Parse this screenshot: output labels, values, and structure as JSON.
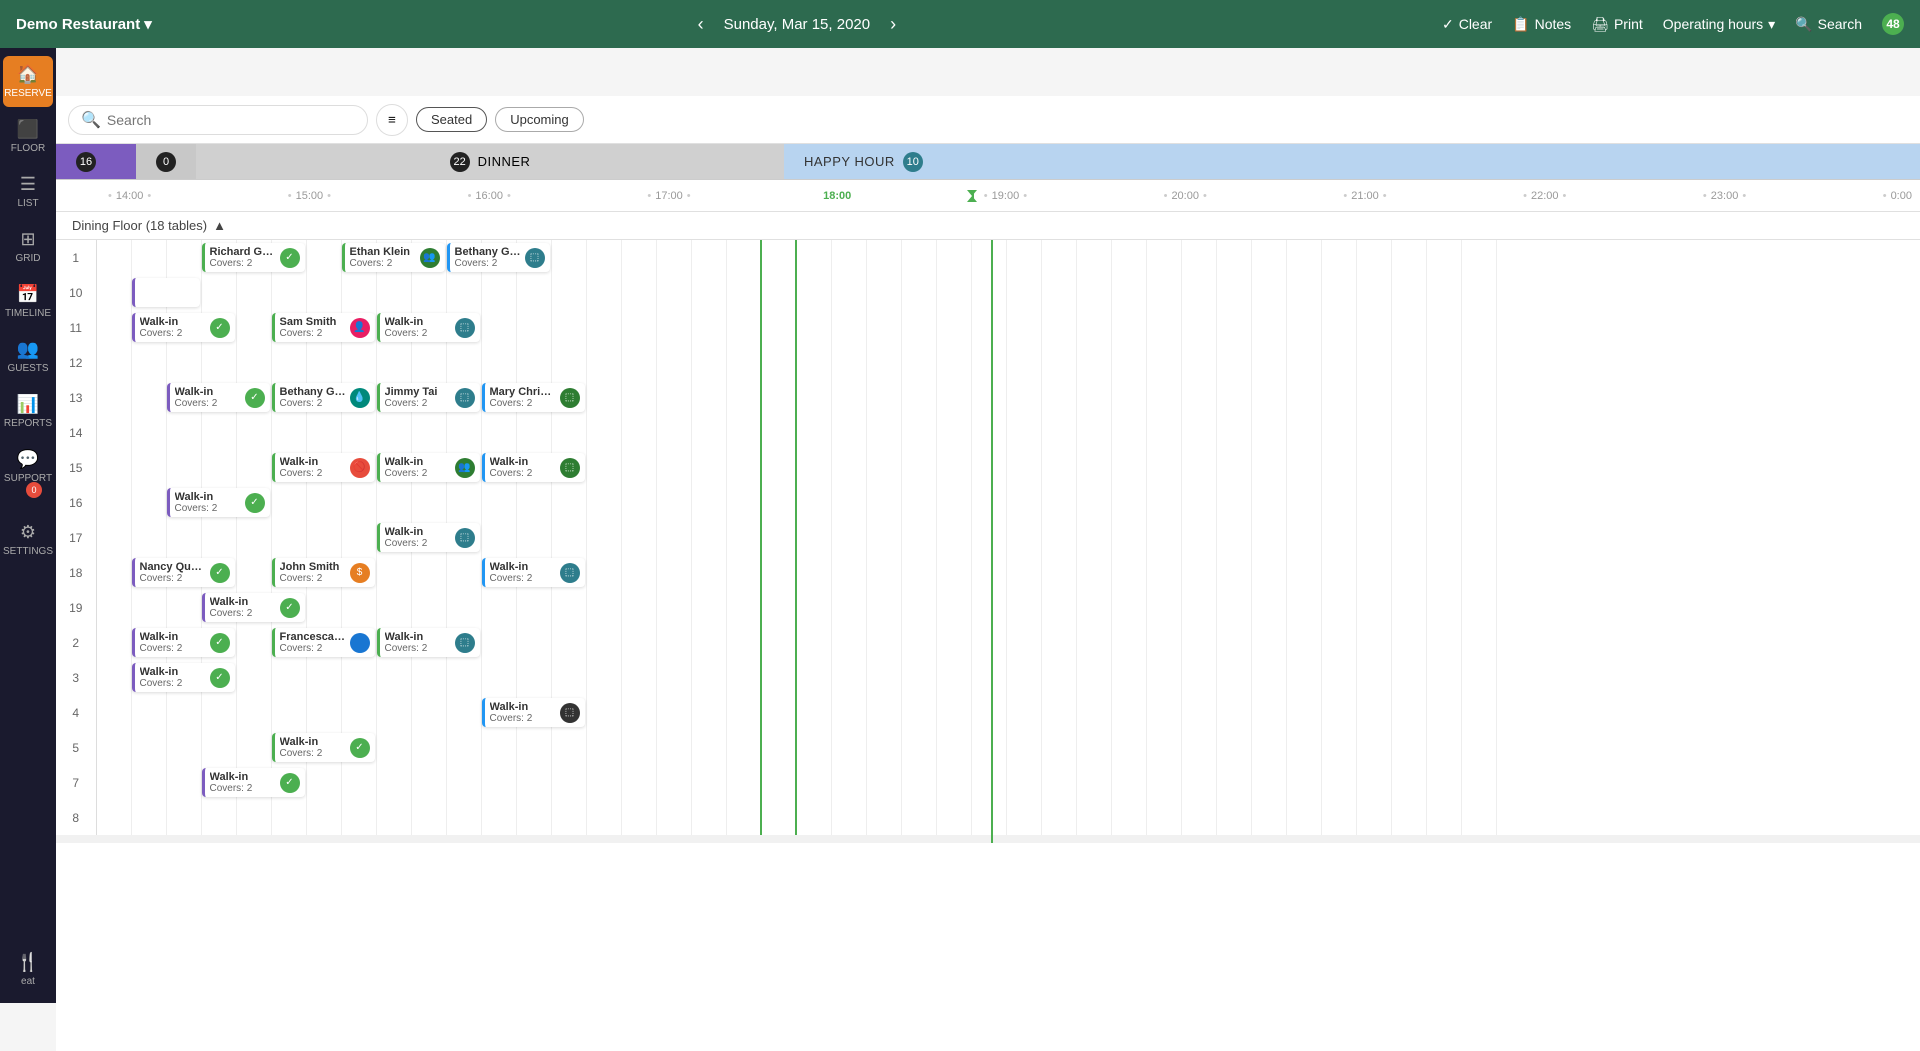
{
  "app": {
    "restaurant_name": "Demo Restaurant",
    "date": "Sunday, Mar 15, 2020",
    "nav_badge": "48"
  },
  "nav": {
    "clear_label": "Clear",
    "notes_label": "Notes",
    "print_label": "Print",
    "operating_hours_label": "Operating hours",
    "search_label": "Search"
  },
  "sidebar": {
    "items": [
      {
        "id": "reserve",
        "label": "RESERVE",
        "icon": "🏠",
        "active": true
      },
      {
        "id": "floor",
        "label": "FLOOR",
        "icon": "⬛"
      },
      {
        "id": "list",
        "label": "LIST",
        "icon": "☰"
      },
      {
        "id": "grid",
        "label": "GRID",
        "icon": "⊞"
      },
      {
        "id": "timeline",
        "label": "TIMELINE",
        "icon": "📅"
      },
      {
        "id": "guests",
        "label": "GUESTS",
        "icon": "👥"
      },
      {
        "id": "reports",
        "label": "REPORTS",
        "icon": "📊"
      },
      {
        "id": "support",
        "label": "SUPPORT",
        "icon": "💬",
        "badge": "0"
      },
      {
        "id": "settings",
        "label": "SETTINGS",
        "icon": "⚙"
      },
      {
        "id": "eat",
        "label": "eat",
        "icon": "🍽"
      }
    ]
  },
  "toolbar": {
    "search_placeholder": "Search",
    "seated_label": "Seated",
    "upcoming_label": "Upcoming"
  },
  "sections": [
    {
      "id": "section1",
      "badge": "16",
      "badge_style": "dark",
      "bg": "purple"
    },
    {
      "id": "section2",
      "badge": "0",
      "badge_style": "dark",
      "bg": "gray"
    },
    {
      "id": "dinner",
      "label": "DINNER",
      "badge": "22",
      "badge_style": "dark",
      "bg": "light-gray"
    },
    {
      "id": "happy_hour",
      "label": "HAPPY HOUR",
      "badge": "10",
      "badge_style": "teal",
      "bg": "light-blue"
    }
  ],
  "floor_label": "Dining Floor (18 tables)",
  "times": [
    "14:00",
    "15:00",
    "16:00",
    "17:00",
    "18:00",
    "19:00",
    "20:00",
    "21:00",
    "22:00",
    "23:00",
    "0:00"
  ],
  "tables": [
    {
      "id": "1"
    },
    {
      "id": "10"
    },
    {
      "id": "11"
    },
    {
      "id": "12"
    },
    {
      "id": "13"
    },
    {
      "id": "14"
    },
    {
      "id": "15"
    },
    {
      "id": "16"
    },
    {
      "id": "17"
    },
    {
      "id": "18"
    },
    {
      "id": "19"
    },
    {
      "id": "2"
    },
    {
      "id": "3"
    },
    {
      "id": "4"
    },
    {
      "id": "5"
    },
    {
      "id": "7"
    },
    {
      "id": "8"
    }
  ],
  "reservations": [
    {
      "id": "r1",
      "table": "1",
      "name": "Richard Gato",
      "covers": "Covers: 2",
      "icon": "✓",
      "icon_style": "icon-green",
      "col_start": 4,
      "col_span": 3,
      "border": "green-border"
    },
    {
      "id": "r2",
      "table": "1",
      "name": "Ethan Klein",
      "covers": "Covers: 2",
      "icon": "👥",
      "icon_style": "icon-dark-green",
      "col_start": 8,
      "col_span": 3,
      "border": "green-border"
    },
    {
      "id": "r3",
      "table": "1",
      "name": "Bethany Green",
      "covers": "Covers: 2",
      "icon": "⬚",
      "icon_style": "icon-teal",
      "col_start": 11,
      "col_span": 3,
      "border": "blue-border"
    },
    {
      "id": "r4",
      "table": "10",
      "name": "",
      "covers": "",
      "icon": "",
      "icon_style": "",
      "col_start": 2,
      "col_span": 2,
      "border": "purple-border"
    },
    {
      "id": "r5",
      "table": "11",
      "name": "Walk-in",
      "covers": "Covers: 2",
      "icon": "✓",
      "icon_style": "icon-green",
      "col_start": 2,
      "col_span": 3,
      "border": "purple-border"
    },
    {
      "id": "r6",
      "table": "11",
      "name": "Sam Smith",
      "covers": "Covers: 2",
      "icon": "👤",
      "icon_style": "icon-pink",
      "col_start": 6,
      "col_span": 3,
      "border": "green-border"
    },
    {
      "id": "r7",
      "table": "11",
      "name": "Walk-in",
      "covers": "Covers: 2",
      "icon": "⬚",
      "icon_style": "icon-teal",
      "col_start": 9,
      "col_span": 3,
      "border": "green-border"
    },
    {
      "id": "r8",
      "table": "13",
      "name": "Walk-in",
      "covers": "Covers: 2",
      "icon": "✓",
      "icon_style": "icon-green",
      "col_start": 3,
      "col_span": 3,
      "border": "purple-border"
    },
    {
      "id": "r9",
      "table": "13",
      "name": "Bethany Green",
      "covers": "Covers: 2",
      "icon": "💧",
      "icon_style": "icon-teal2",
      "col_start": 6,
      "col_span": 3,
      "border": "green-border"
    },
    {
      "id": "r10",
      "table": "13",
      "name": "Jimmy Tai",
      "covers": "Covers: 2",
      "icon": "⬚",
      "icon_style": "icon-teal",
      "col_start": 9,
      "col_span": 3,
      "border": "green-border"
    },
    {
      "id": "r11",
      "table": "13",
      "name": "Mary Christianson",
      "covers": "Covers: 2",
      "icon": "⬚",
      "icon_style": "icon-dark-green",
      "col_start": 12,
      "col_span": 3,
      "border": "blue-border"
    },
    {
      "id": "r12",
      "table": "15",
      "name": "Walk-in",
      "covers": "Covers: 2",
      "icon": "🚫",
      "icon_style": "icon-red",
      "col_start": 6,
      "col_span": 3,
      "border": "green-border"
    },
    {
      "id": "r13",
      "table": "15",
      "name": "Walk-in",
      "covers": "Covers: 2",
      "icon": "👥",
      "icon_style": "icon-dark-green",
      "col_start": 9,
      "col_span": 3,
      "border": "green-border"
    },
    {
      "id": "r14",
      "table": "15",
      "name": "Walk-in",
      "covers": "Covers: 2",
      "icon": "⬚",
      "icon_style": "icon-dark-green",
      "col_start": 12,
      "col_span": 3,
      "border": "blue-border"
    },
    {
      "id": "r15",
      "table": "16",
      "name": "Walk-in",
      "covers": "Covers: 2",
      "icon": "✓",
      "icon_style": "icon-green",
      "col_start": 3,
      "col_span": 3,
      "border": "purple-border"
    },
    {
      "id": "r16",
      "table": "17",
      "name": "Walk-in",
      "covers": "Covers: 2",
      "icon": "⬚",
      "icon_style": "icon-teal",
      "col_start": 9,
      "col_span": 3,
      "border": "green-border"
    },
    {
      "id": "r17",
      "table": "18",
      "name": "Nancy Quentin",
      "covers": "Covers: 2",
      "icon": "✓",
      "icon_style": "icon-green",
      "col_start": 2,
      "col_span": 3,
      "border": "purple-border"
    },
    {
      "id": "r18",
      "table": "18",
      "name": "John Smith",
      "covers": "Covers: 2",
      "icon": "$",
      "icon_style": "icon-orange",
      "col_start": 6,
      "col_span": 3,
      "border": "green-border"
    },
    {
      "id": "r19",
      "table": "18",
      "name": "Walk-in",
      "covers": "Covers: 2",
      "icon": "⬚",
      "icon_style": "icon-teal",
      "col_start": 12,
      "col_span": 3,
      "border": "blue-border"
    },
    {
      "id": "r20",
      "table": "19",
      "name": "Walk-in",
      "covers": "Covers: 2",
      "icon": "✓",
      "icon_style": "icon-green",
      "col_start": 4,
      "col_span": 3,
      "border": "purple-border"
    },
    {
      "id": "r21",
      "table": "2",
      "name": "Walk-in",
      "covers": "Covers: 2",
      "icon": "✓",
      "icon_style": "icon-green",
      "col_start": 2,
      "col_span": 3,
      "border": "purple-border"
    },
    {
      "id": "r22",
      "table": "2",
      "name": "Francesca Webheinser",
      "covers": "Covers: 2",
      "icon": "👤",
      "icon_style": "icon-blue",
      "col_start": 6,
      "col_span": 3,
      "border": "green-border"
    },
    {
      "id": "r23",
      "table": "2",
      "name": "Walk-in",
      "covers": "Covers: 2",
      "icon": "⬚",
      "icon_style": "icon-teal",
      "col_start": 9,
      "col_span": 3,
      "border": "green-border"
    },
    {
      "id": "r24",
      "table": "3",
      "name": "Walk-in",
      "covers": "Covers: 2",
      "icon": "✓",
      "icon_style": "icon-green",
      "col_start": 2,
      "col_span": 3,
      "border": "purple-border"
    },
    {
      "id": "r25",
      "table": "4",
      "name": "Walk-in",
      "covers": "Covers: 2",
      "icon": "⬚",
      "icon_style": "icon-dark",
      "col_start": 12,
      "col_span": 3,
      "border": "blue-border"
    },
    {
      "id": "r26",
      "table": "5",
      "name": "Walk-in",
      "covers": "Covers: 2",
      "icon": "✓",
      "icon_style": "icon-green",
      "col_start": 6,
      "col_span": 3,
      "border": "green-border"
    },
    {
      "id": "r27",
      "table": "7",
      "name": "Walk-in",
      "covers": "Covers: 2",
      "icon": "✓",
      "icon_style": "icon-green",
      "col_start": 4,
      "col_span": 3,
      "border": "purple-border"
    }
  ]
}
